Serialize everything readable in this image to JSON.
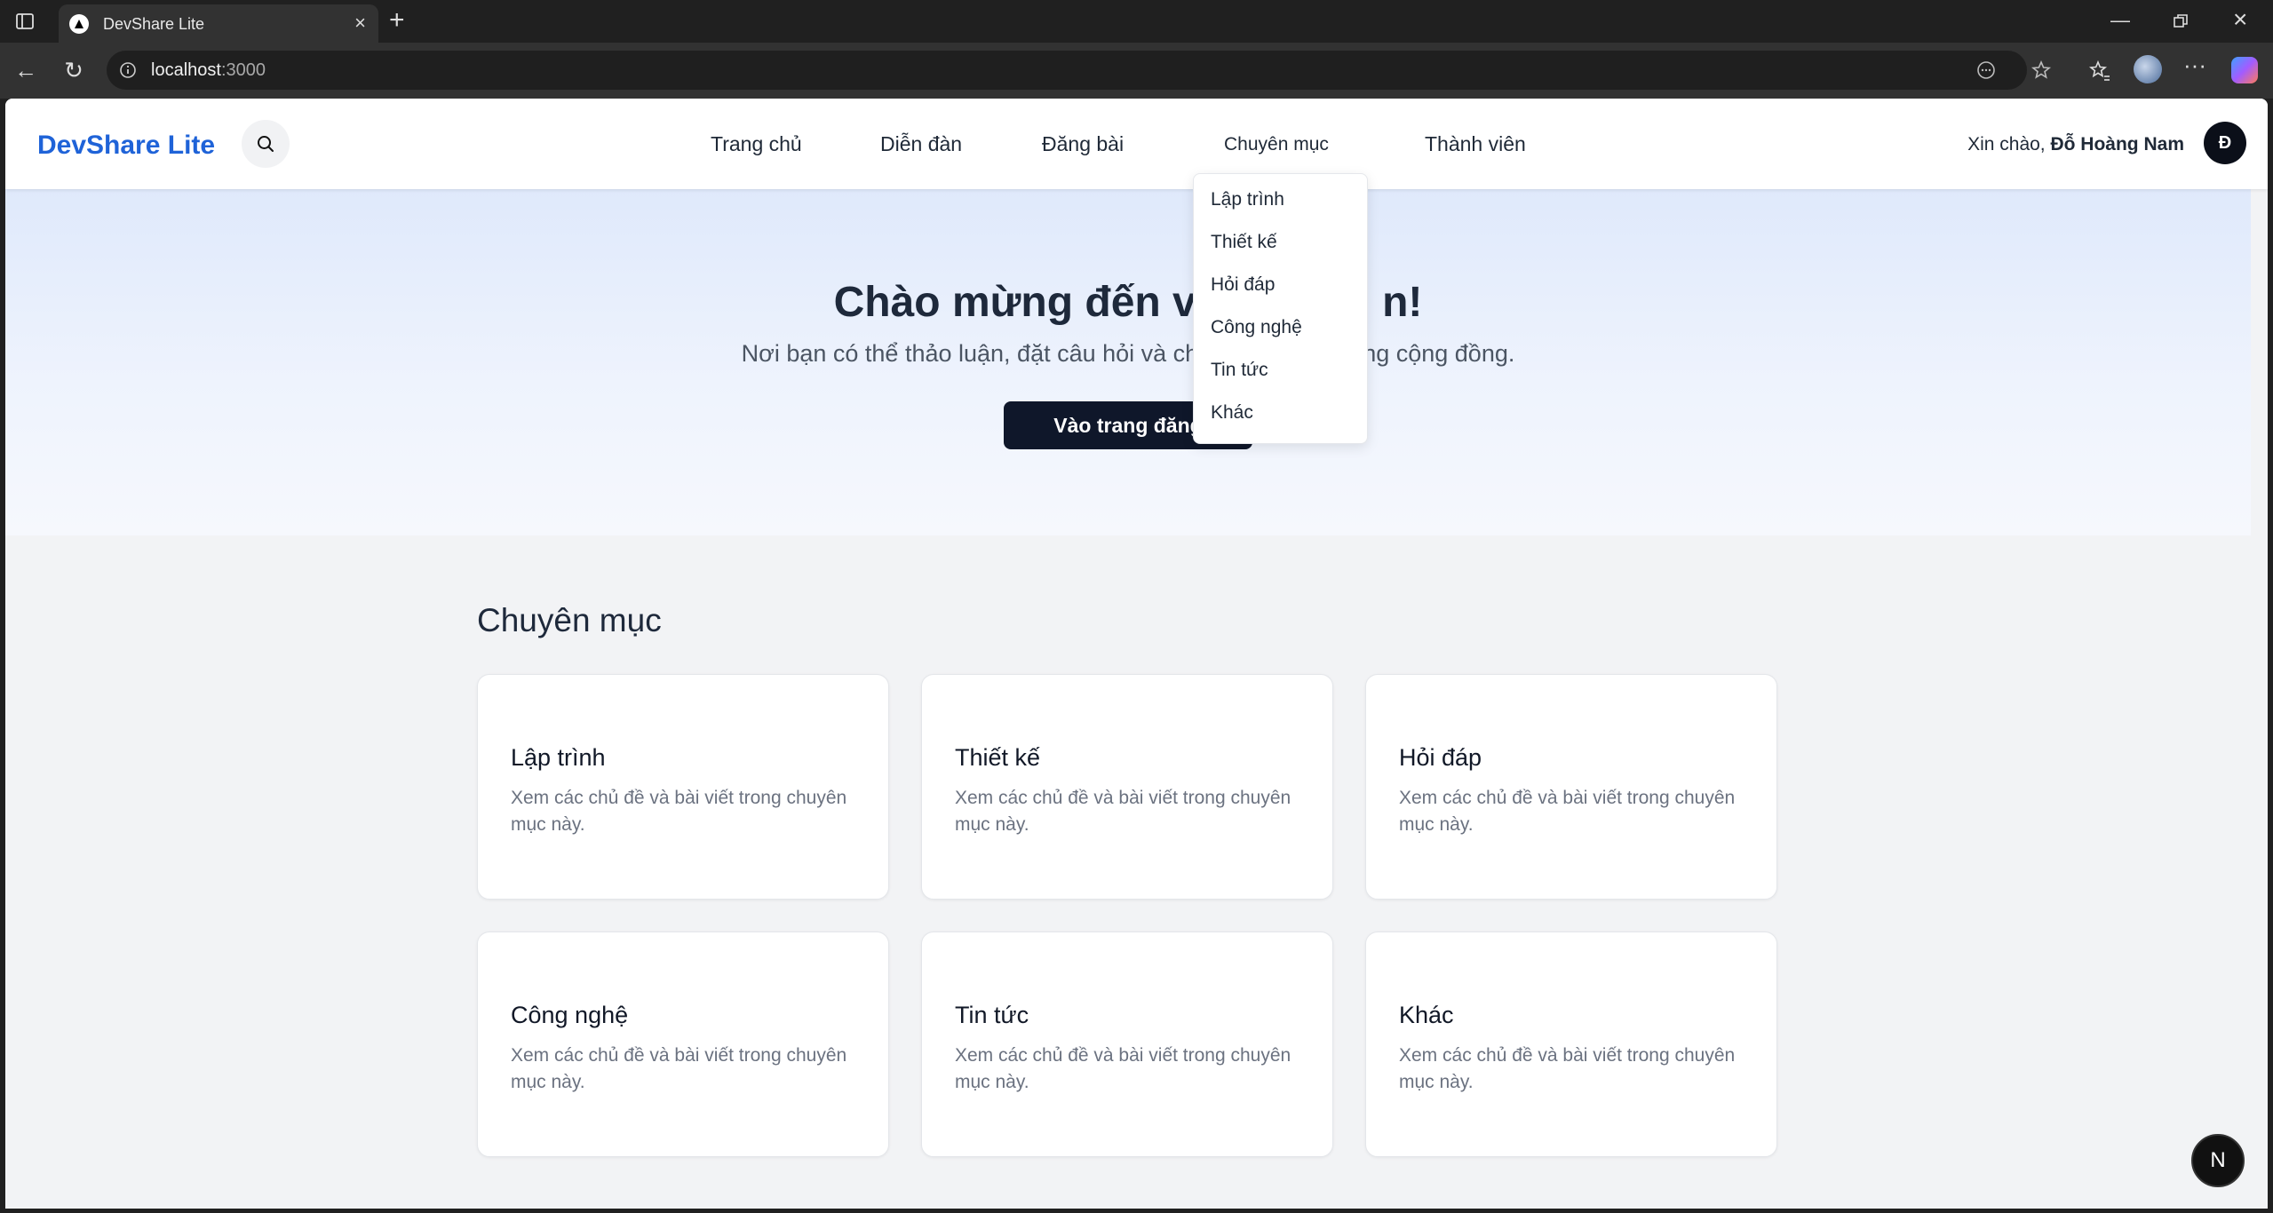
{
  "browser": {
    "tab_title": "DevShare Lite",
    "url_host": "localhost",
    "url_port": ":3000"
  },
  "navbar": {
    "brand": "DevShare Lite",
    "links": [
      "Trang chủ",
      "Diễn đàn",
      "Đăng bài",
      "Chuyên mục",
      "Thành viên"
    ],
    "greeting_prefix": "Xin chào,",
    "user_name": "Đỗ Hoàng Nam",
    "avatar_initial": "Đ"
  },
  "dropdown": {
    "items": [
      "Lập trình",
      "Thiết kế",
      "Hỏi đáp",
      "Công nghệ",
      "Tin tức",
      "Khác"
    ]
  },
  "hero": {
    "title": "Chào mừng đến vó",
    "title_end": "n!",
    "subtitle": "Nơi bạn có thể thảo luận, đặt câu hỏi và chi",
    "subtitle_end": "ung cộng đồng.",
    "button": "Vào trang đăng"
  },
  "categories": {
    "title": "Chuyên mục",
    "cards": [
      {
        "title": "Lập trình",
        "desc": "Xem các chủ đề và bài viết trong chuyên mục này."
      },
      {
        "title": "Thiết kế",
        "desc": "Xem các chủ đề và bài viết trong chuyên mục này."
      },
      {
        "title": "Hỏi đáp",
        "desc": "Xem các chủ đề và bài viết trong chuyên mục này."
      },
      {
        "title": "Công nghệ",
        "desc": "Xem các chủ đề và bài viết trong chuyên mục này."
      },
      {
        "title": "Tin tức",
        "desc": "Xem các chủ đề và bài viết trong chuyên mục này."
      },
      {
        "title": "Khác",
        "desc": "Xem các chủ đề và bài viết trong chuyên mục này."
      }
    ]
  },
  "fab_label": "N",
  "colors": {
    "brand": "#1f63d8",
    "dark_button": "#0f172a",
    "page_bg": "#f2f3f5"
  }
}
